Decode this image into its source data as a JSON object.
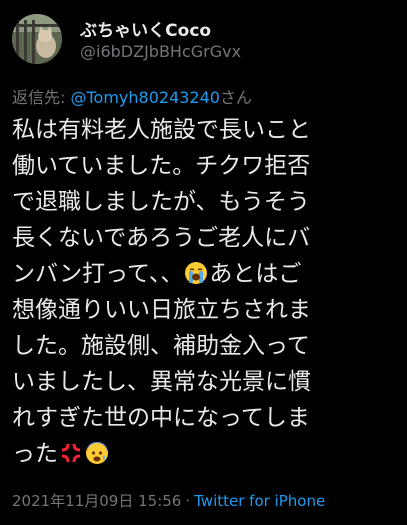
{
  "user": {
    "display_name": "ぶちゃいくCoco",
    "handle": "@i6bDZJbBHcGrGvx"
  },
  "reply": {
    "prefix": "返信先: ",
    "mention": "@Tomyh80243240",
    "suffix": "さん"
  },
  "tweet": {
    "lines": [
      "私は有料老人施設で長いこと",
      "働いていました。チクワ拒否",
      "で退職しましたが、もうそう",
      "長くないであろうご老人にバ",
      "ンバン打って、、",
      "あとはご",
      "想像通りいい日旅立ちされま",
      "した。施設側、補助金入って",
      "いましたし、異常な光景に慣",
      "れすぎた世の中になってしま",
      "った"
    ],
    "emojis": [
      "loudly-crying-face",
      "anger-symbol",
      "fearful-face"
    ]
  },
  "meta": {
    "timestamp": "2021年11月09日 15:56",
    "separator": "·",
    "source": "Twitter for iPhone"
  },
  "colors": {
    "background": "#000000",
    "text": "#e7e9ea",
    "secondary": "#71767b",
    "link": "#1d9bf0"
  }
}
